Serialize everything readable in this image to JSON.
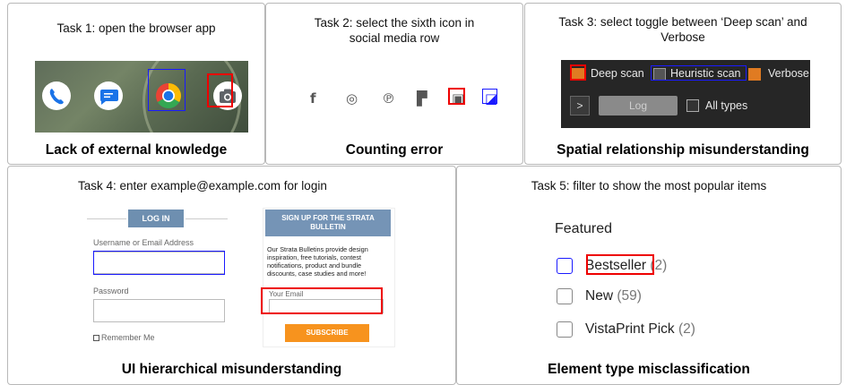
{
  "panels": [
    {
      "task": "Task 1: open the browser app",
      "caption": "Lack of external knowledge"
    },
    {
      "task": "Task 2: select the sixth icon in social media row",
      "caption": "Counting error"
    },
    {
      "task": "Task 3: select toggle between ‘Deep scan’ and Verbose",
      "caption": "Spatial relationship misunderstanding"
    },
    {
      "task": "Task 4: enter example@example.com for login",
      "caption": "UI hierarchical misunderstanding"
    },
    {
      "task": "Task 5: filter to show the most popular items",
      "caption": "Element type misclassification"
    }
  ],
  "colors": {
    "error_box": "#e00000",
    "correct_box": "#1a1aff",
    "orange": "#e07b22"
  },
  "panel1": {
    "apps": [
      "phone-icon",
      "messages-icon",
      "chrome-icon",
      "camera-icon"
    ]
  },
  "panel2": {
    "icons": [
      "f",
      "◎",
      "℗",
      "▛",
      "▣",
      "◪"
    ]
  },
  "panel3": {
    "deep_scan": "Deep scan",
    "heuristic_scan": "Heuristic scan",
    "verbose": "Verbose",
    "arrow": ">",
    "log": "Log",
    "all_types": "All types"
  },
  "panel4": {
    "login_header": "LOG IN",
    "username_label": "Username or Email Address",
    "password_label": "Password",
    "remember_me": "Remember Me",
    "signup_header": "SIGN UP FOR THE STRATA BULLETIN",
    "signup_text": "Our Strata Bulletins provide design inspiration, free tutorials, contest notifications, product and bundle discounts, case studies and more!",
    "your_email": "Your Email",
    "subscribe": "SUBSCRIBE"
  },
  "panel5": {
    "header": "Featured",
    "items": [
      {
        "label": "Bestseller",
        "count": "(2)"
      },
      {
        "label": "New",
        "count": "(59)"
      },
      {
        "label": "VistaPrint Pick",
        "count": "(2)"
      }
    ]
  }
}
